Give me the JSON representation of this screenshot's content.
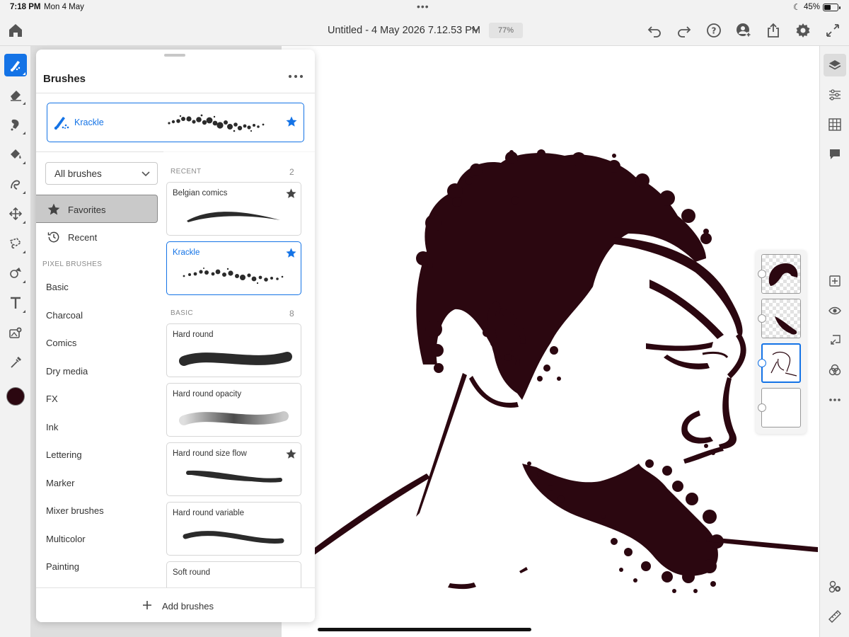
{
  "status_bar": {
    "time": "7:18 PM",
    "date": "Mon 4 May",
    "battery": "45%"
  },
  "document": {
    "title": "Untitled - 4 May 2026 7.12.53 PM",
    "zoom": "77%"
  },
  "toolbar": {
    "left_icons": [
      "home-icon"
    ],
    "right_icons": [
      "undo-icon",
      "redo-icon",
      "help-icon",
      "invite-icon",
      "share-icon",
      "settings-icon",
      "fullscreen-icon"
    ]
  },
  "tools": [
    "brush-icon",
    "eraser-icon",
    "smudge-icon",
    "fill-icon",
    "liquify-icon",
    "transform-icon",
    "lasso-icon",
    "shape-icon",
    "text-icon",
    "place-image-icon",
    "eyedropper-icon"
  ],
  "current_color": "#2b0710",
  "panel": {
    "title": "Brushes",
    "current_brush": "Krackle",
    "filter": "All brushes",
    "favorites_label": "Favorites",
    "recent_label": "Recent",
    "section_label": "PIXEL BRUSHES",
    "categories": [
      "Basic",
      "Charcoal",
      "Comics",
      "Dry media",
      "FX",
      "Ink",
      "Lettering",
      "Marker",
      "Mixer brushes",
      "Multicolor",
      "Painting"
    ],
    "recent_header": "RECENT",
    "recent_count": "2",
    "recent": [
      {
        "name": "Belgian comics",
        "favorite": true
      },
      {
        "name": "Krackle",
        "favorite": true,
        "selected": true
      }
    ],
    "basic_header": "BASIC",
    "basic_count": "8",
    "basic": [
      {
        "name": "Hard round",
        "favorite": false
      },
      {
        "name": "Hard round opacity",
        "favorite": false
      },
      {
        "name": "Hard round size flow",
        "favorite": true
      },
      {
        "name": "Hard round variable",
        "favorite": false
      },
      {
        "name": "Soft round",
        "favorite": false
      }
    ],
    "add_label": "Add brushes"
  },
  "right_rail": [
    "layers-icon",
    "adjustments-icon",
    "grid-icon",
    "comments-icon",
    "add-layer-icon",
    "visibility-icon",
    "merge-down-icon",
    "blend-mode-icon",
    "more-icon",
    "layer-properties-icon",
    "ruler-icon"
  ],
  "colors": {
    "accent": "#1473e6",
    "ink": "#2b0710"
  }
}
